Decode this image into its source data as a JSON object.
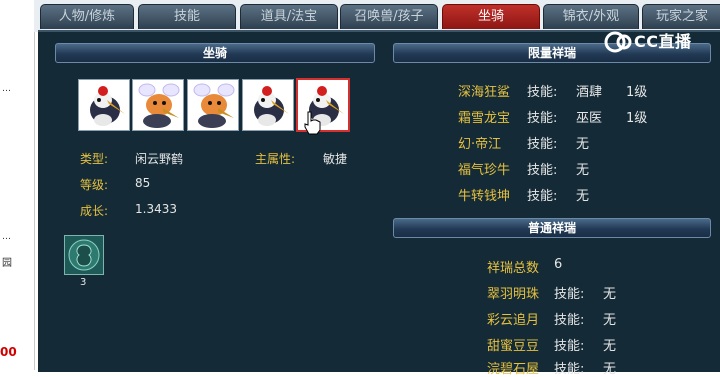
{
  "tabs": [
    {
      "label": "人物/修炼",
      "active": false
    },
    {
      "label": "技能",
      "active": false
    },
    {
      "label": "道具/法宝",
      "active": false
    },
    {
      "label": "召唤兽/孩子",
      "active": false
    },
    {
      "label": "坐骑",
      "active": true
    },
    {
      "label": "锦衣/外观",
      "active": false
    },
    {
      "label": "玩家之家",
      "active": false
    }
  ],
  "left_strip": {
    "dots": [
      "…",
      "…"
    ],
    "partial_text": "00",
    "partial_char": "园"
  },
  "mount": {
    "header": "坐骑",
    "pets": [
      "crane",
      "dragon",
      "dragon",
      "crane",
      "crane-selected"
    ],
    "type_label": "类型:",
    "type_value": "闲云野鹤",
    "attr_label": "主属性:",
    "attr_value": "敏捷",
    "level_label": "等级:",
    "level_value": "85",
    "growth_label": "成长:",
    "growth_value": "1.3433",
    "item_count": "3"
  },
  "limited": {
    "header": "限量祥瑞",
    "rows": [
      {
        "name": "深海狂鲨",
        "skill_label": "技能:",
        "skill": "酒肆",
        "level": "1级"
      },
      {
        "name": "霜雪龙宝",
        "skill_label": "技能:",
        "skill": "巫医",
        "level": "1级"
      },
      {
        "name": "幻·帝江",
        "skill_label": "技能:",
        "skill": "无",
        "level": ""
      },
      {
        "name": "福气珍牛",
        "skill_label": "技能:",
        "skill": "无",
        "level": ""
      },
      {
        "name": "牛转钱坤",
        "skill_label": "技能:",
        "skill": "无",
        "level": ""
      }
    ]
  },
  "normal": {
    "header": "普通祥瑞",
    "total_label": "祥瑞总数",
    "total_value": "6",
    "rows": [
      {
        "name": "翠羽明珠",
        "skill_label": "技能:",
        "skill": "无"
      },
      {
        "name": "彩云追月",
        "skill_label": "技能:",
        "skill": "无"
      },
      {
        "name": "甜蜜豆豆",
        "skill_label": "技能:",
        "skill": "无"
      },
      {
        "name": "浣碧石屋",
        "skill_label": "技能:",
        "skill": "无"
      }
    ]
  },
  "watermark": {
    "text": "CC直播"
  }
}
